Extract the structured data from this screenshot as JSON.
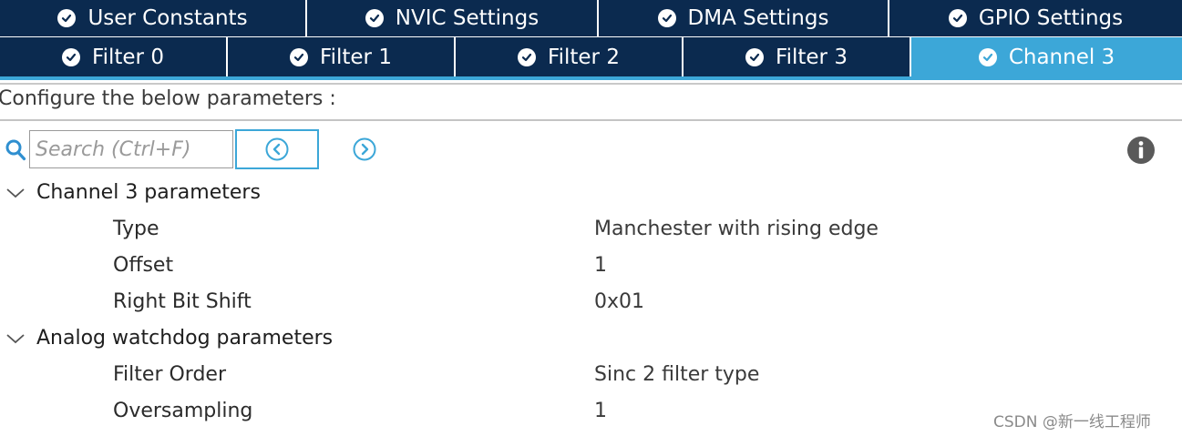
{
  "tabs_top": [
    {
      "label": "User Constants"
    },
    {
      "label": "NVIC Settings"
    },
    {
      "label": "DMA Settings"
    },
    {
      "label": "GPIO Settings"
    }
  ],
  "tabs_second": [
    {
      "label": "Filter 0"
    },
    {
      "label": "Filter 1"
    },
    {
      "label": "Filter 2"
    },
    {
      "label": "Filter 3"
    },
    {
      "label": "Channel 3",
      "active": true
    }
  ],
  "configure_label": "Configure the below parameters :",
  "search": {
    "placeholder": "Search (Ctrl+F)"
  },
  "groups": [
    {
      "title": "Channel 3 parameters",
      "params": [
        {
          "name": "Type",
          "value": "Manchester with rising edge"
        },
        {
          "name": "Offset",
          "value": "1"
        },
        {
          "name": "Right Bit Shift",
          "value": "0x01"
        }
      ]
    },
    {
      "title": "Analog watchdog parameters",
      "params": [
        {
          "name": "Filter Order",
          "value": "Sinc 2 filter type"
        },
        {
          "name": "Oversampling",
          "value": "1"
        }
      ]
    }
  ],
  "watermark": "CSDN @新一线工程师",
  "colors": {
    "tab_bg": "#0b2a4f",
    "tab_active": "#3ca7d8",
    "accent": "#3ca7d8"
  }
}
